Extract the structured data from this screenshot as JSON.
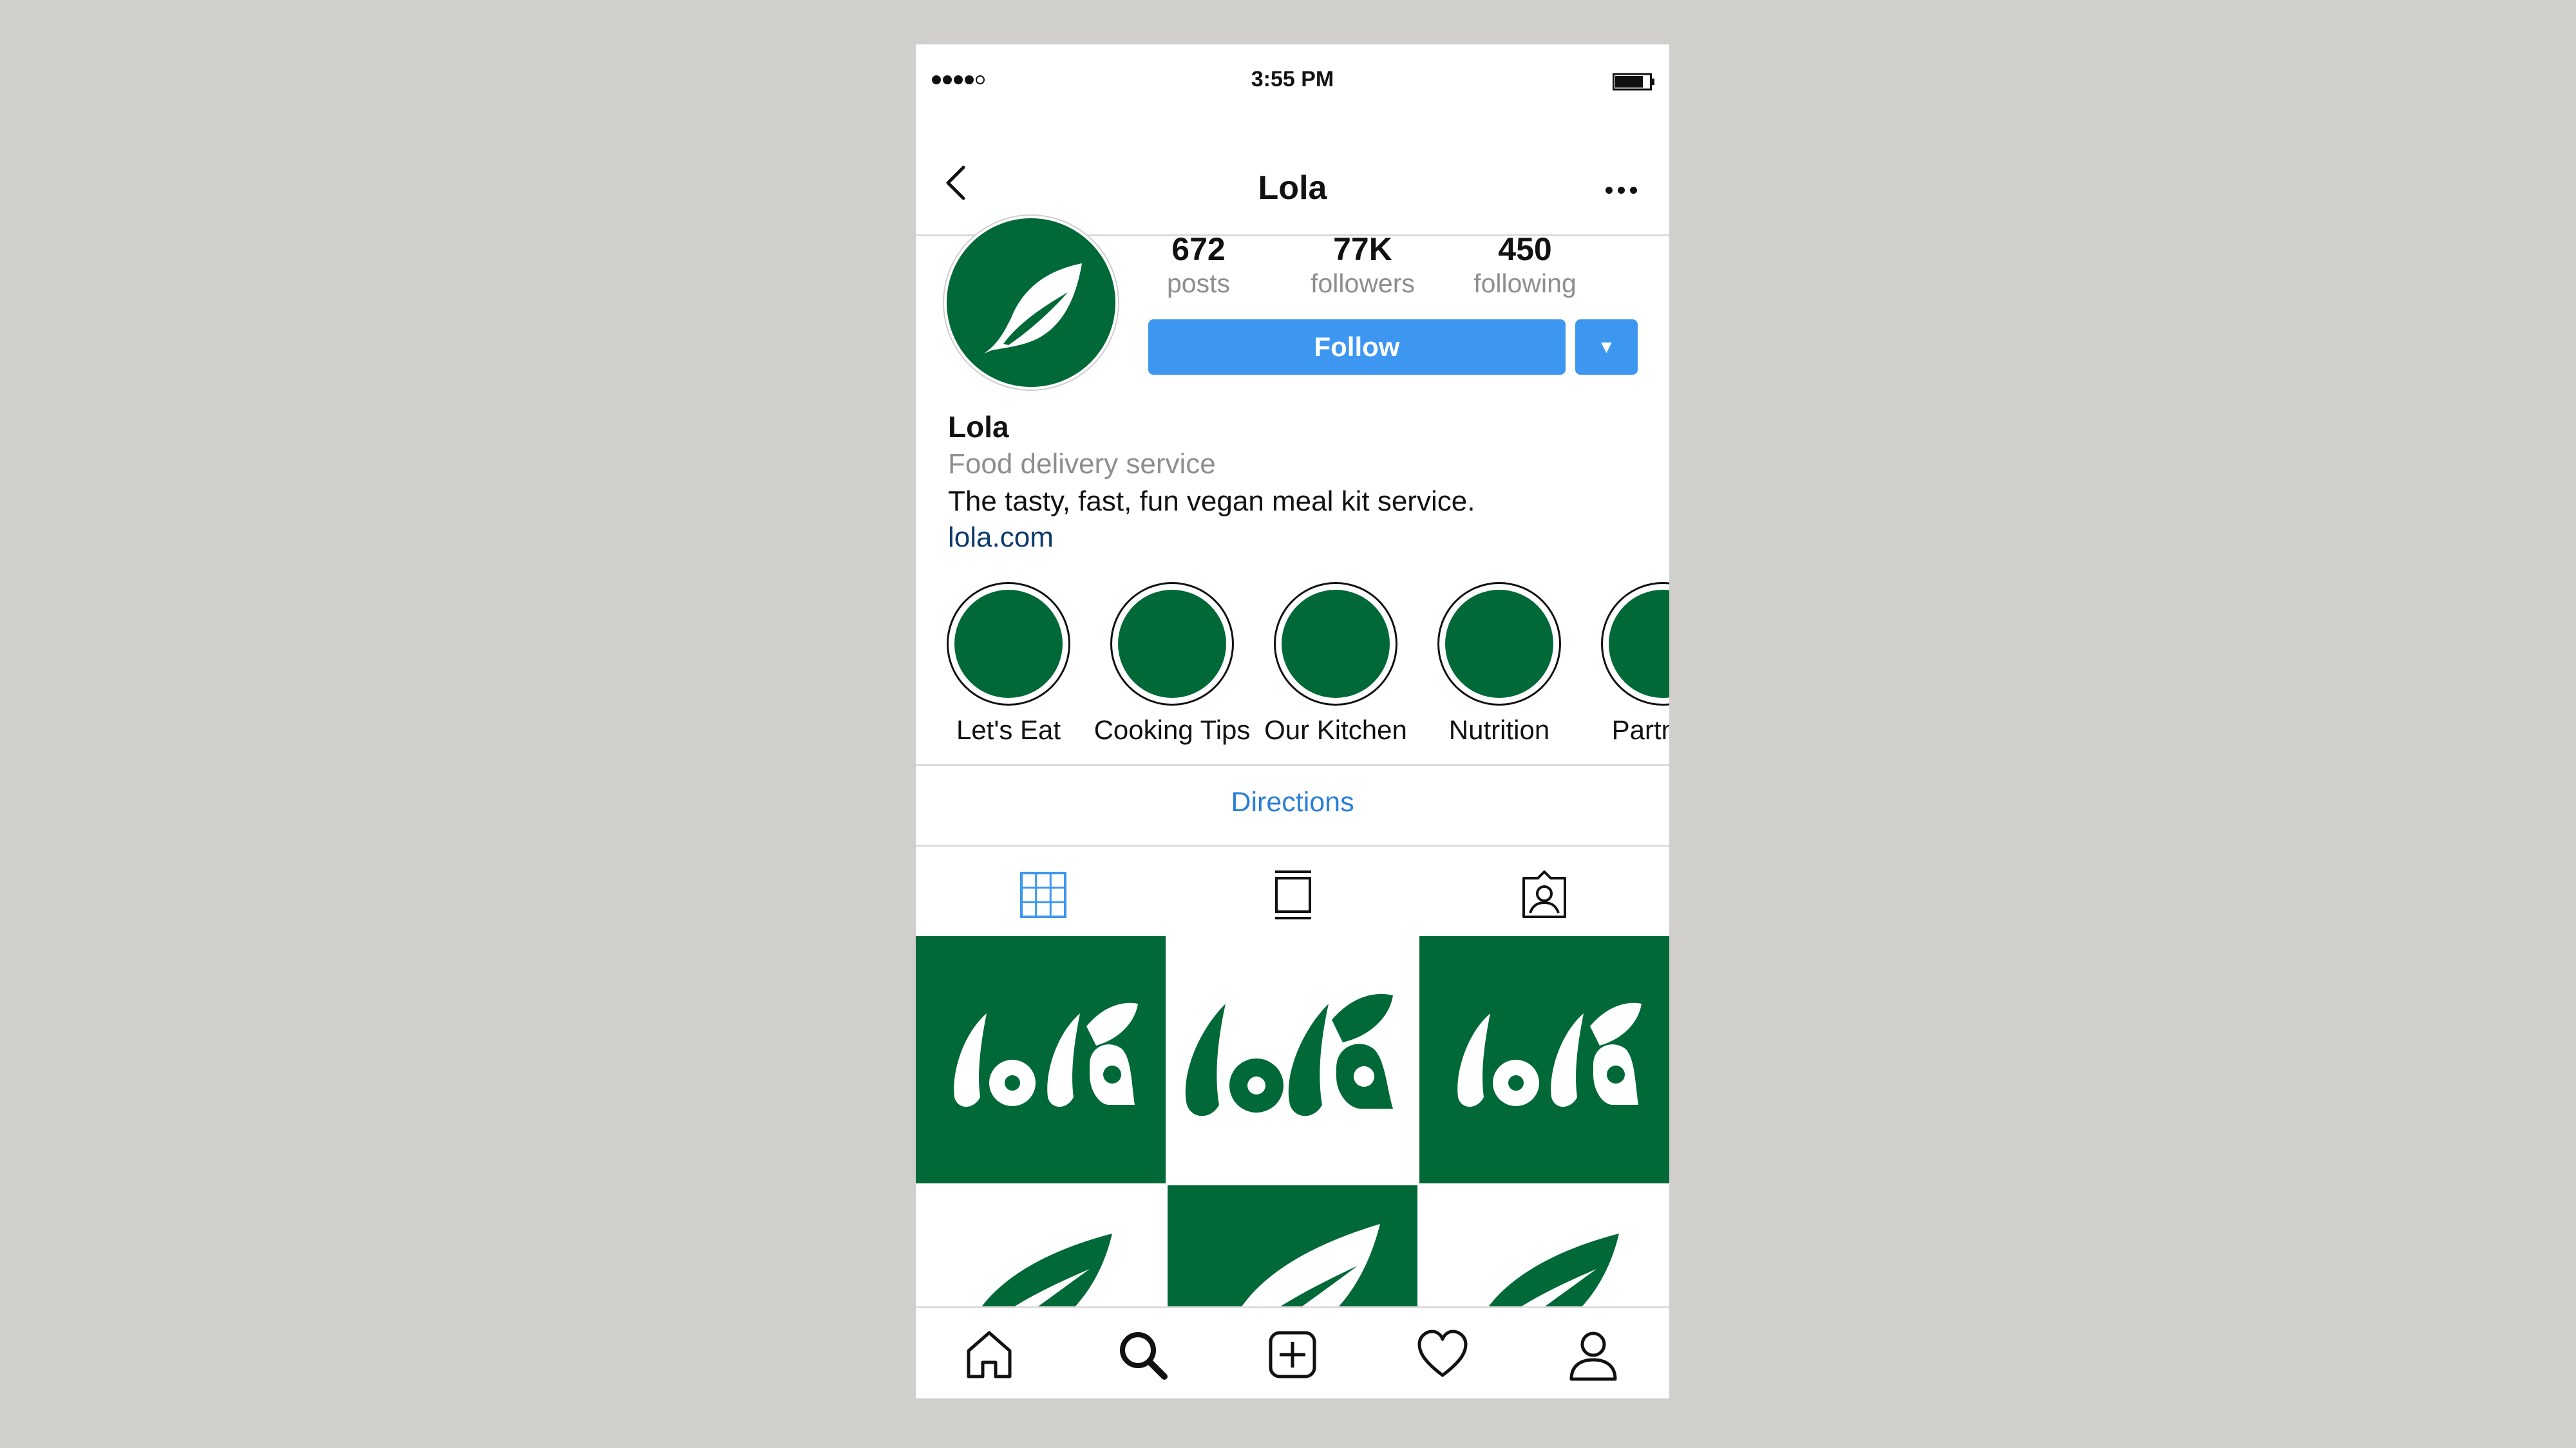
{
  "status_bar": {
    "time": "3:55 PM",
    "signal_bars": 4,
    "signal_empty": 1
  },
  "nav": {
    "back_icon": "back-arrow-icon",
    "title": "Lola",
    "more_icon": "more-icon"
  },
  "profile": {
    "avatar_icon": "leaf-logo-icon",
    "stats": [
      {
        "value": "672",
        "label": "posts"
      },
      {
        "value": "77K",
        "label": "followers"
      },
      {
        "value": "450",
        "label": "following"
      }
    ],
    "follow_label": "Follow",
    "dropdown_glyph": "▼",
    "name": "Lola",
    "category": "Food delivery service",
    "bio": "The tasty, fast, fun vegan meal kit service.",
    "link": "lola.com"
  },
  "highlights": [
    {
      "label": "Let's Eat"
    },
    {
      "label": "Cooking Tips"
    },
    {
      "label": "Our Kitchen"
    },
    {
      "label": "Nutrition"
    },
    {
      "label": "Partners"
    }
  ],
  "directions_label": "Directions",
  "tabs": [
    {
      "name": "grid-icon",
      "active": true
    },
    {
      "name": "feed-icon",
      "active": false
    },
    {
      "name": "tagged-icon",
      "active": false
    }
  ],
  "grid": [
    {
      "type": "lola-wordmark",
      "background": "green"
    },
    {
      "type": "lola-wordmark",
      "background": "white"
    },
    {
      "type": "lola-wordmark",
      "background": "green"
    },
    {
      "type": "leaf",
      "background": "white"
    },
    {
      "type": "leaf",
      "background": "green"
    },
    {
      "type": "leaf",
      "background": "white"
    }
  ],
  "bottom_nav": [
    "home-icon",
    "search-icon",
    "add-post-icon",
    "activity-heart-icon",
    "profile-icon"
  ],
  "colors": {
    "brand_green": "#006937",
    "follow_blue": "#3d97f0",
    "link_blue": "#0c3a6e",
    "active_tab": "#3d97f0"
  }
}
